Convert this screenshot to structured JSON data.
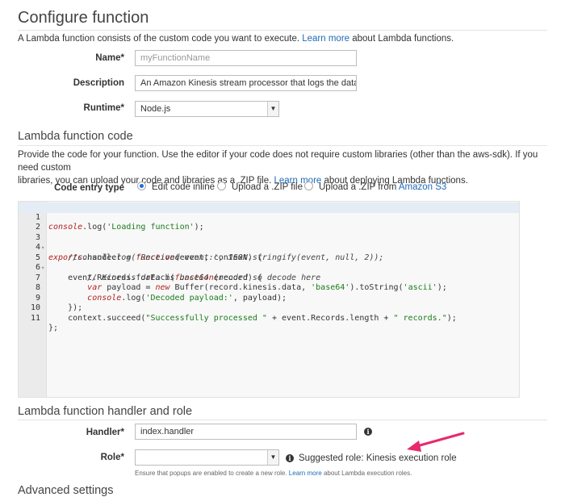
{
  "configure": {
    "title": "Configure function",
    "intro_text": "A Lambda function consists of the custom code you want to execute. ",
    "intro_link": "Learn more",
    "intro_suffix": " about Lambda functions.",
    "name_label": "Name",
    "name_placeholder": "myFunctionName",
    "description_label": "Description",
    "description_value": "An Amazon Kinesis stream processor that logs the data being",
    "runtime_label": "Runtime",
    "runtime_value": "Node.js"
  },
  "code_section": {
    "title": "Lambda function code",
    "desc_line1": "Provide the code for your function. Use the editor if your code does not require custom libraries (other than the aws-sdk). If you need custom",
    "desc_line2_prefix": "libraries, you can upload your code and libraries as a .ZIP file. ",
    "desc_link": "Learn more",
    "desc_line2_suffix": " about deploying Lambda functions.",
    "entry_label": "Code entry type",
    "options": [
      {
        "label": "Edit code inline",
        "selected": true
      },
      {
        "label": "Upload a .ZIP file",
        "selected": false
      },
      {
        "label": "Upload a .ZIP from ",
        "link": "Amazon S3",
        "selected": false
      }
    ]
  },
  "editor": {
    "lines": [
      {
        "n": "1",
        "fold": ""
      },
      {
        "n": "2",
        "fold": ""
      },
      {
        "n": "3",
        "fold": "▾"
      },
      {
        "n": "4",
        "fold": ""
      },
      {
        "n": "5",
        "fold": "▾"
      },
      {
        "n": "6",
        "fold": ""
      },
      {
        "n": "7",
        "fold": ""
      },
      {
        "n": "8",
        "fold": ""
      },
      {
        "n": "9",
        "fold": ""
      },
      {
        "n": "10",
        "fold": ""
      },
      {
        "n": "11",
        "fold": ""
      }
    ],
    "tokens": {
      "l1a": "console",
      "l1b": ".log(",
      "l1c": "'Loading function'",
      "l1d": ");",
      "l3a": "exports",
      "l3b": ".handler = ",
      "l3c": "function",
      "l3d": "(event, context) {",
      "l4": "    //console.log('Received event:', JSON.stringify(event, null, 2));",
      "l5a": "    event.Records.forEach(",
      "l5b": "function",
      "l5c": "(record) {",
      "l6": "        // Kinesis data is base64 encoded so decode here",
      "l7a": "        ",
      "l7b": "var",
      "l7c": " payload = ",
      "l7d": "new",
      "l7e": " Buffer(record.kinesis.data, ",
      "l7f": "'base64'",
      "l7g": ").toString(",
      "l7h": "'ascii'",
      "l7i": ");",
      "l8a": "        ",
      "l8b": "console",
      "l8c": ".log(",
      "l8d": "'Decoded payload:'",
      "l8e": ", payload);",
      "l9": "    });",
      "l10a": "    context.succeed(",
      "l10b": "\"Successfully processed \"",
      "l10c": " + event.Records.length + ",
      "l10d": "\" records.\"",
      "l10e": ");",
      "l11": "};"
    }
  },
  "handler_section": {
    "title": "Lambda function handler and role",
    "handler_label": "Handler",
    "handler_value": "index.handler",
    "role_label": "Role",
    "role_value": "",
    "suggested_text": "Suggested role: Kinesis execution role",
    "hint_prefix": "Ensure that popups are enabled to create a new role. ",
    "hint_link": "Learn more",
    "hint_suffix": " about Lambda execution roles."
  },
  "next_section": {
    "title": "Advanced settings"
  },
  "colors": {
    "link": "#1f6bb5",
    "annotation_arrow": "#e8296d",
    "radio_selected": "#1c6ee8"
  }
}
